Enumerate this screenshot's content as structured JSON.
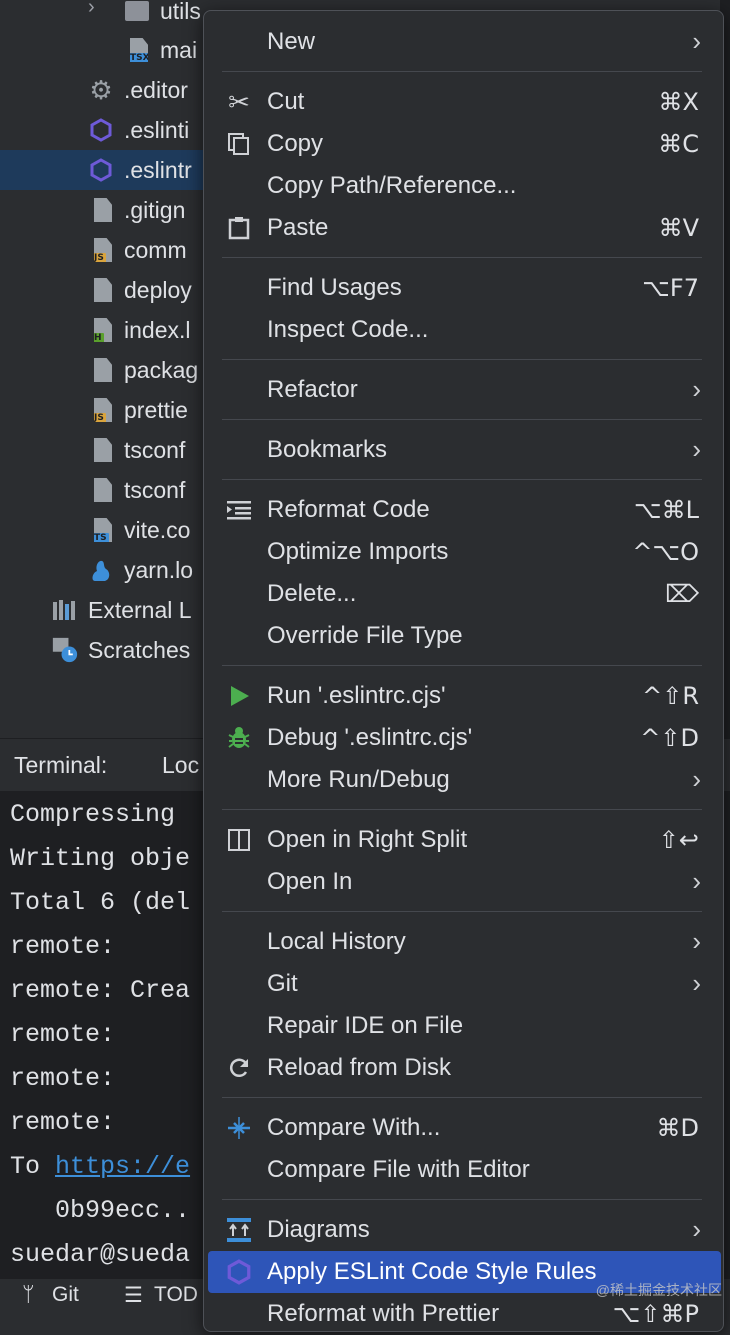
{
  "tree": {
    "items": [
      {
        "label": "utils",
        "kind": "folder"
      },
      {
        "label": "mai",
        "kind": "file",
        "badge": "TSX",
        "badge_color": "#3d8fd9"
      },
      {
        "label": ".editor",
        "kind": "gear"
      },
      {
        "label": ".eslinti",
        "kind": "eslint"
      },
      {
        "label": ".eslintr",
        "kind": "eslint",
        "selected": true
      },
      {
        "label": ".gitign",
        "kind": "file"
      },
      {
        "label": "comm",
        "kind": "file",
        "badge": "JS",
        "badge_color": "#d9a43d"
      },
      {
        "label": "deploy",
        "kind": "json"
      },
      {
        "label": "index.l",
        "kind": "file",
        "badge": "H",
        "badge_color": "#5aa02c"
      },
      {
        "label": "packag",
        "kind": "json"
      },
      {
        "label": "prettie",
        "kind": "file",
        "badge": "JS",
        "badge_color": "#d9a43d"
      },
      {
        "label": "tsconf",
        "kind": "json"
      },
      {
        "label": "tsconf",
        "kind": "json"
      },
      {
        "label": "vite.co",
        "kind": "file",
        "badge": "TS",
        "badge_color": "#3d8fd9"
      },
      {
        "label": "yarn.lo",
        "kind": "yarn"
      },
      {
        "label": "External L",
        "kind": "external"
      },
      {
        "label": "Scratches",
        "kind": "scratches"
      }
    ]
  },
  "terminal": {
    "tab_label": "Terminal:",
    "tab_local": "Loc",
    "lines": [
      "Compressing",
      "Writing obje",
      "Total 6 (del",
      "remote:",
      "remote: Crea",
      "remote:",
      "remote:",
      "remote:",
      "To ",
      "   0b99ecc..",
      "suedar@sueda"
    ],
    "link_text": "https://e"
  },
  "status_bar": {
    "git_label": "Git",
    "todo_label": "TOD"
  },
  "menu": {
    "items": [
      {
        "label": "New",
        "submenu": true
      },
      {
        "label": "Cut",
        "shortcut": "⌘X",
        "icon": "scissors-icon"
      },
      {
        "label": "Copy",
        "shortcut": "⌘C",
        "icon": "copy-icon"
      },
      {
        "label": "Copy Path/Reference..."
      },
      {
        "label": "Paste",
        "shortcut": "⌘V",
        "icon": "paste-icon"
      },
      {
        "label": "Find Usages",
        "shortcut": "⌥F7"
      },
      {
        "label": "Inspect Code..."
      },
      {
        "label": "Refactor",
        "submenu": true
      },
      {
        "label": "Bookmarks",
        "submenu": true
      },
      {
        "label": "Reformat Code",
        "shortcut": "⌥⌘L",
        "icon": "reformat-icon"
      },
      {
        "label": "Optimize Imports",
        "shortcut": "^⌥O"
      },
      {
        "label": "Delete...",
        "shortcut": "⌦"
      },
      {
        "label": "Override File Type"
      },
      {
        "label": "Run '.eslintrc.cjs'",
        "shortcut": "^⇧R",
        "icon": "run-icon"
      },
      {
        "label": "Debug '.eslintrc.cjs'",
        "shortcut": "^⇧D",
        "icon": "debug-icon"
      },
      {
        "label": "More Run/Debug",
        "submenu": true
      },
      {
        "label": "Open in Right Split",
        "shortcut": "⇧↩",
        "icon": "split-icon"
      },
      {
        "label": "Open In",
        "submenu": true
      },
      {
        "label": "Local History",
        "submenu": true
      },
      {
        "label": "Git",
        "submenu": true
      },
      {
        "label": "Repair IDE on File"
      },
      {
        "label": "Reload from Disk",
        "icon": "reload-icon"
      },
      {
        "label": "Compare With...",
        "shortcut": "⌘D",
        "icon": "compare-icon"
      },
      {
        "label": "Compare File with Editor"
      },
      {
        "label": "Diagrams",
        "submenu": true,
        "icon": "diagrams-icon"
      },
      {
        "label": "Apply ESLint Code Style Rules",
        "icon": "eslint-icon",
        "highlighted": true
      },
      {
        "label": "Reformat with Prettier",
        "shortcut": "⌥⇧⌘P"
      }
    ]
  },
  "watermark": "@稀土掘金技术社区",
  "colors": {
    "selection": "#1e3a5b",
    "menu_highlight": "#2e55b8",
    "run_green": "#4cae4f",
    "link_blue": "#3d8fd9",
    "eslint_purple": "#6e5ad8"
  }
}
